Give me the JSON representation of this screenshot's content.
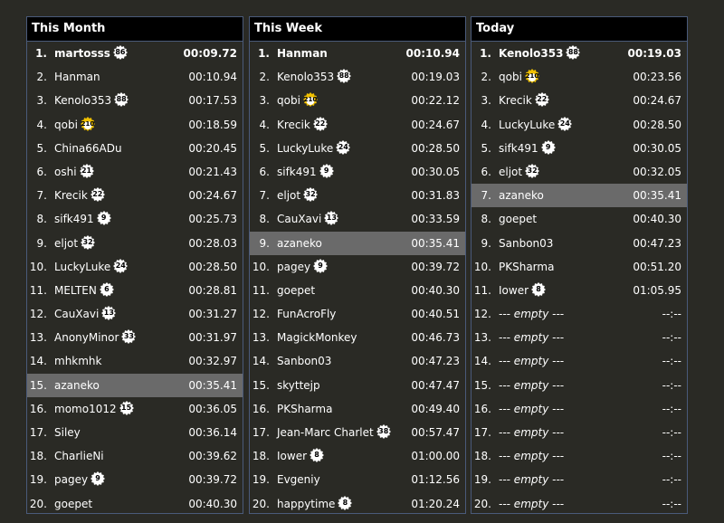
{
  "colors": {
    "background": "#2a2a25",
    "header": "#000000",
    "highlight": "#6a6a6a",
    "border": "#4a5a7a",
    "badge": "#ffffff",
    "gold_badge": "#f0c000"
  },
  "panels": [
    {
      "title": "This Month",
      "rows": [
        {
          "rank": "1.",
          "name": "martosss",
          "badge": "86",
          "time": "00:09.72",
          "top": true
        },
        {
          "rank": "2.",
          "name": "Hanman",
          "badge": "",
          "time": "00:10.94"
        },
        {
          "rank": "3.",
          "name": "Kenolo353",
          "badge": "88",
          "time": "00:17.53"
        },
        {
          "rank": "4.",
          "name": "qobi",
          "badge": "210",
          "gold": true,
          "time": "00:18.59"
        },
        {
          "rank": "5.",
          "name": "China66ADu",
          "badge": "",
          "time": "00:20.45"
        },
        {
          "rank": "6.",
          "name": "oshi",
          "badge": "21",
          "time": "00:21.43"
        },
        {
          "rank": "7.",
          "name": "Krecik",
          "badge": "22",
          "time": "00:24.67"
        },
        {
          "rank": "8.",
          "name": "sifk491",
          "badge": "9",
          "time": "00:25.73"
        },
        {
          "rank": "9.",
          "name": "eljot",
          "badge": "32",
          "time": "00:28.03"
        },
        {
          "rank": "10.",
          "name": "LuckyLuke",
          "badge": "24",
          "time": "00:28.50"
        },
        {
          "rank": "11.",
          "name": "MELTEN",
          "badge": "6",
          "time": "00:28.81"
        },
        {
          "rank": "12.",
          "name": "CauXavi",
          "badge": "13",
          "time": "00:31.27"
        },
        {
          "rank": "13.",
          "name": "AnonyMinor",
          "badge": "33",
          "time": "00:31.97"
        },
        {
          "rank": "14.",
          "name": "mhkmhk",
          "badge": "",
          "time": "00:32.97"
        },
        {
          "rank": "15.",
          "name": "azaneko",
          "badge": "",
          "time": "00:35.41",
          "highlight": true
        },
        {
          "rank": "16.",
          "name": "momo1012",
          "badge": "15",
          "time": "00:36.05"
        },
        {
          "rank": "17.",
          "name": "Siley",
          "badge": "",
          "time": "00:36.14"
        },
        {
          "rank": "18.",
          "name": "CharlieNi",
          "badge": "",
          "time": "00:39.62"
        },
        {
          "rank": "19.",
          "name": "pagey",
          "badge": "9",
          "time": "00:39.72"
        },
        {
          "rank": "20.",
          "name": "goepet",
          "badge": "",
          "time": "00:40.30"
        }
      ]
    },
    {
      "title": "This Week",
      "rows": [
        {
          "rank": "1.",
          "name": "Hanman",
          "badge": "",
          "time": "00:10.94",
          "top": true
        },
        {
          "rank": "2.",
          "name": "Kenolo353",
          "badge": "88",
          "time": "00:19.03"
        },
        {
          "rank": "3.",
          "name": "qobi",
          "badge": "210",
          "gold": true,
          "time": "00:22.12"
        },
        {
          "rank": "4.",
          "name": "Krecik",
          "badge": "22",
          "time": "00:24.67"
        },
        {
          "rank": "5.",
          "name": "LuckyLuke",
          "badge": "24",
          "time": "00:28.50"
        },
        {
          "rank": "6.",
          "name": "sifk491",
          "badge": "9",
          "time": "00:30.05"
        },
        {
          "rank": "7.",
          "name": "eljot",
          "badge": "32",
          "time": "00:31.83"
        },
        {
          "rank": "8.",
          "name": "CauXavi",
          "badge": "13",
          "time": "00:33.59"
        },
        {
          "rank": "9.",
          "name": "azaneko",
          "badge": "",
          "time": "00:35.41",
          "highlight": true
        },
        {
          "rank": "10.",
          "name": "pagey",
          "badge": "9",
          "time": "00:39.72"
        },
        {
          "rank": "11.",
          "name": "goepet",
          "badge": "",
          "time": "00:40.30"
        },
        {
          "rank": "12.",
          "name": "FunAcroFly",
          "badge": "",
          "time": "00:40.51"
        },
        {
          "rank": "13.",
          "name": "MagickMonkey",
          "badge": "",
          "time": "00:46.73"
        },
        {
          "rank": "14.",
          "name": "Sanbon03",
          "badge": "",
          "time": "00:47.23"
        },
        {
          "rank": "15.",
          "name": "skyttejp",
          "badge": "",
          "time": "00:47.47"
        },
        {
          "rank": "16.",
          "name": "PKSharma",
          "badge": "",
          "time": "00:49.40"
        },
        {
          "rank": "17.",
          "name": "Jean-Marc Charlet",
          "badge": "38",
          "time": "00:57.47"
        },
        {
          "rank": "18.",
          "name": "Iower",
          "badge": "8",
          "time": "01:00.00"
        },
        {
          "rank": "19.",
          "name": "Evgeniy",
          "badge": "",
          "time": "01:12.56"
        },
        {
          "rank": "20.",
          "name": "happytime",
          "badge": "8",
          "time": "01:20.24"
        }
      ]
    },
    {
      "title": "Today",
      "rows": [
        {
          "rank": "1.",
          "name": "Kenolo353",
          "badge": "88",
          "time": "00:19.03",
          "top": true
        },
        {
          "rank": "2.",
          "name": "qobi",
          "badge": "210",
          "gold": true,
          "time": "00:23.56"
        },
        {
          "rank": "3.",
          "name": "Krecik",
          "badge": "22",
          "time": "00:24.67"
        },
        {
          "rank": "4.",
          "name": "LuckyLuke",
          "badge": "24",
          "time": "00:28.50"
        },
        {
          "rank": "5.",
          "name": "sifk491",
          "badge": "9",
          "time": "00:30.05"
        },
        {
          "rank": "6.",
          "name": "eljot",
          "badge": "32",
          "time": "00:32.05"
        },
        {
          "rank": "7.",
          "name": "azaneko",
          "badge": "",
          "time": "00:35.41",
          "highlight": true
        },
        {
          "rank": "8.",
          "name": "goepet",
          "badge": "",
          "time": "00:40.30"
        },
        {
          "rank": "9.",
          "name": "Sanbon03",
          "badge": "",
          "time": "00:47.23"
        },
        {
          "rank": "10.",
          "name": "PKSharma",
          "badge": "",
          "time": "00:51.20"
        },
        {
          "rank": "11.",
          "name": "Iower",
          "badge": "8",
          "time": "01:05.95"
        },
        {
          "rank": "12.",
          "name": "--- empty ---",
          "badge": "",
          "time": "--:--",
          "empty": true
        },
        {
          "rank": "13.",
          "name": "--- empty ---",
          "badge": "",
          "time": "--:--",
          "empty": true
        },
        {
          "rank": "14.",
          "name": "--- empty ---",
          "badge": "",
          "time": "--:--",
          "empty": true
        },
        {
          "rank": "15.",
          "name": "--- empty ---",
          "badge": "",
          "time": "--:--",
          "empty": true
        },
        {
          "rank": "16.",
          "name": "--- empty ---",
          "badge": "",
          "time": "--:--",
          "empty": true
        },
        {
          "rank": "17.",
          "name": "--- empty ---",
          "badge": "",
          "time": "--:--",
          "empty": true
        },
        {
          "rank": "18.",
          "name": "--- empty ---",
          "badge": "",
          "time": "--:--",
          "empty": true
        },
        {
          "rank": "19.",
          "name": "--- empty ---",
          "badge": "",
          "time": "--:--",
          "empty": true
        },
        {
          "rank": "20.",
          "name": "--- empty ---",
          "badge": "",
          "time": "--:--",
          "empty": true
        }
      ]
    }
  ]
}
